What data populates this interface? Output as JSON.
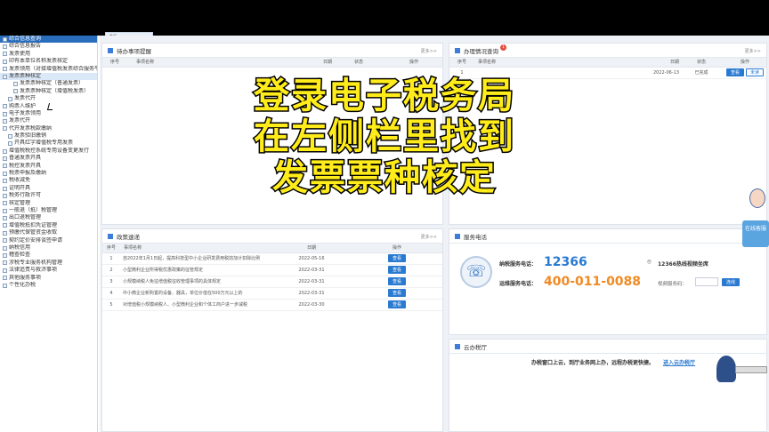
{
  "top_tab": "首页",
  "sidebar": {
    "items": [
      {
        "label": "综合信息查询",
        "level": 0,
        "state": "hl"
      },
      {
        "label": "综合信息报告",
        "level": 0
      },
      {
        "label": "发票使用",
        "level": 0
      },
      {
        "label": "印有本单位名称发票核定",
        "level": 0
      },
      {
        "label": "发票领用（对接增值税发票综合服务平台）",
        "level": 0
      },
      {
        "label": "发票票种核定",
        "level": 0,
        "state": "sel"
      },
      {
        "label": "发票票种核定（普通发票）",
        "level": 2
      },
      {
        "label": "发票票种核定（增值税发票）",
        "level": 2
      },
      {
        "label": "发票代开",
        "level": 1
      },
      {
        "label": "购票人维护",
        "level": 0
      },
      {
        "label": "电子发票领用",
        "level": 0
      },
      {
        "label": "发票代开",
        "level": 0
      },
      {
        "label": "代开发票税款缴纳",
        "level": 0
      },
      {
        "label": "发票验旧缴销",
        "level": 1
      },
      {
        "label": "开具红字增值税专用发票",
        "level": 1
      },
      {
        "label": "增值税税控系统专用设备变更发行",
        "level": 0
      },
      {
        "label": "普通发票开具",
        "level": 0
      },
      {
        "label": "税控发票开具",
        "level": 0
      },
      {
        "label": "税票申报及缴纳",
        "level": 0
      },
      {
        "label": "税收减免",
        "level": 0
      },
      {
        "label": "证明开具",
        "level": 0
      },
      {
        "label": "税务行政许可",
        "level": 0
      },
      {
        "label": "核定管理",
        "level": 0
      },
      {
        "label": "一般退（抵）税管理",
        "level": 0
      },
      {
        "label": "出口退税管理",
        "level": 0
      },
      {
        "label": "增值税抵扣凭证管理",
        "level": 0
      },
      {
        "label": "预缴代保管资金收取",
        "level": 0
      },
      {
        "label": "契约定价安排谈签申请",
        "level": 0
      },
      {
        "label": "纳税信用",
        "level": 0
      },
      {
        "label": "稽查检查",
        "level": 0
      },
      {
        "label": "涉税专业服务机构管理",
        "level": 0
      },
      {
        "label": "法律追责与救济事项",
        "level": 0
      },
      {
        "label": "其他服务事项",
        "level": 0
      },
      {
        "label": "个性化办税",
        "level": 0
      }
    ]
  },
  "todo": {
    "title": "待办事项提醒",
    "more": "更多>>",
    "headers": [
      "序号",
      "事项名称",
      "日期",
      "状态",
      "操作"
    ]
  },
  "progress": {
    "title": "办理情况查询",
    "badge": "1",
    "more": "更多>>",
    "headers": [
      "序号",
      "事项名称",
      "日期",
      "状态",
      "操作"
    ],
    "rows": [
      {
        "no": "1",
        "name": "",
        "date": "2022-06-13",
        "status": "已完成",
        "btn1": "查看",
        "btn2": "未读"
      }
    ]
  },
  "policy": {
    "title": "政策速递",
    "more": "更多>>",
    "headers": [
      "序号",
      "事项名称",
      "日期",
      "操作"
    ],
    "rows": [
      {
        "no": "1",
        "name": "自2022年1月1日起，提高科技型中小企业研发费用税前加计扣除比例",
        "date": "2022-05-16",
        "btn": "查看"
      },
      {
        "no": "2",
        "name": "小型微利企业所得税优惠政策的征管规定",
        "date": "2022-03-31",
        "btn": "查看"
      },
      {
        "no": "3",
        "name": "小规模纳税人免征增值税征收管理事项的具体规定",
        "date": "2022-03-31",
        "btn": "查看"
      },
      {
        "no": "4",
        "name": "中小微企业新购置的设备、器具，单位价值在500万元以上的",
        "date": "2022-03-31",
        "btn": "查看"
      },
      {
        "no": "5",
        "name": "对增值税小规模纳税人、小型微利企业和个体工商户进一步减税",
        "date": "2022-03-30",
        "btn": "查看"
      }
    ]
  },
  "service": {
    "title": "服务电话",
    "hotline_label": "纳税服务电话：",
    "hotline": "12366",
    "ops_label": "运维服务电话：",
    "ops": "400-011-0088",
    "video_label": "12366热线视频坐席",
    "video_code_label": "视频服务码：",
    "connect_btn": "连线"
  },
  "cloud": {
    "title": "云办税厅",
    "text": "办税窗口上云，到厅业务网上办，远程办税更快捷。",
    "link": "进入云办税厅"
  },
  "kefu": {
    "label": "在线客服"
  },
  "overlay": {
    "line1": "登录电子税务局",
    "line2": "在左侧栏里找到",
    "line3": "发票票种核定"
  },
  "colors": {
    "accent": "#2a7ad1",
    "hotline": "#2a7ad1",
    "ops": "#f08a24",
    "overlay": "#ffec1a"
  }
}
